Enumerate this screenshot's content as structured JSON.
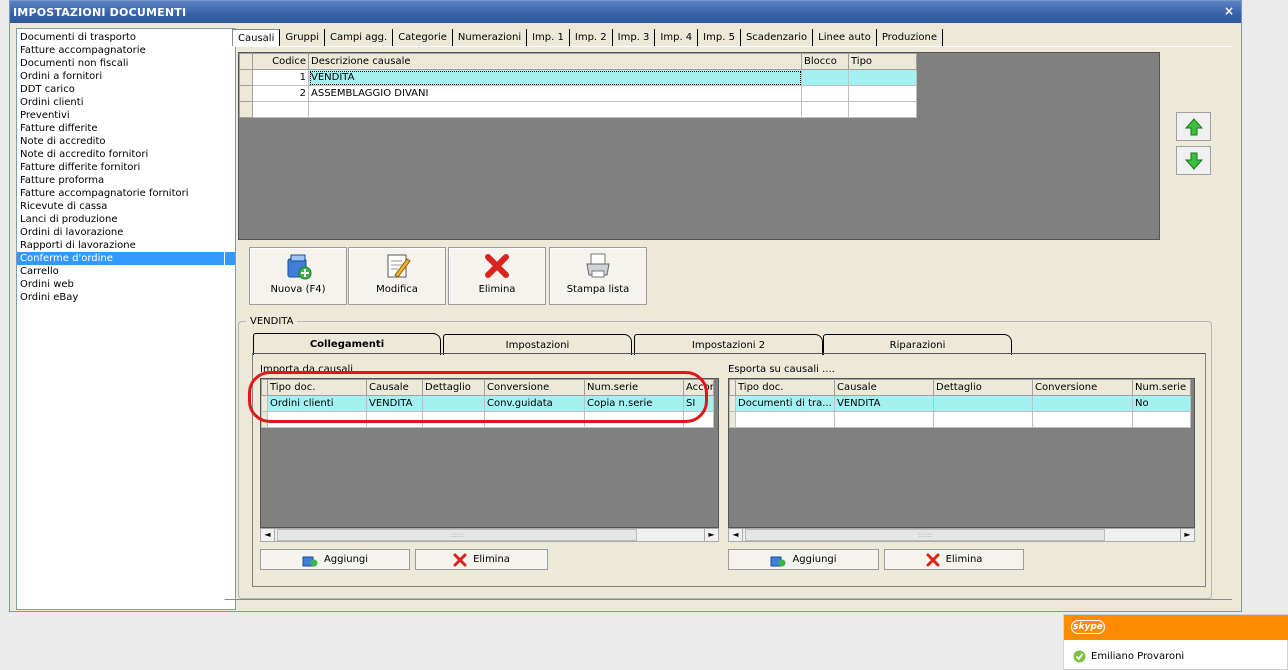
{
  "window": {
    "title": "IMPOSTAZIONI DOCUMENTI",
    "close": "×"
  },
  "doc_list": [
    "Documenti di trasporto",
    "Fatture accompagnatorie",
    "Documenti non fiscali",
    "Ordini a fornitori",
    "DDT carico",
    "Ordini clienti",
    "Preventivi",
    "Fatture differite",
    "Note di accredito",
    "Note di accredito fornitori",
    "Fatture differite fornitori",
    "Fatture proforma",
    "Fatture accompagnatorie fornitori",
    "Ricevute di cassa",
    "Lanci di produzione",
    "Ordini di lavorazione",
    "Rapporti di lavorazione",
    "Conferme d'ordine",
    "Carrello",
    "Ordini web",
    "Ordini eBay"
  ],
  "selected_doc": "Conferme d'ordine",
  "tabs": [
    "Causali",
    "Gruppi",
    "Campi agg.",
    "Categorie",
    "Numerazioni",
    "Imp. 1",
    "Imp. 2",
    "Imp. 3",
    "Imp. 4",
    "Imp. 5",
    "Scadenzario",
    "Linee auto",
    "Produzione"
  ],
  "active_tab": "Causali",
  "causali_grid": {
    "headers": [
      "Codice",
      "Descrizione causale",
      "Blocco",
      "Tipo"
    ],
    "rows": [
      [
        "1",
        "VENDITA",
        "",
        ""
      ],
      [
        "2",
        "ASSEMBLAGGIO DIVANI",
        "",
        ""
      ]
    ]
  },
  "buttons": {
    "nuova": "Nuova (F4)",
    "modifica": "Modifica",
    "elimina": "Elimina",
    "stampa": "Stampa lista"
  },
  "group_title": "VENDITA",
  "lower_tabs": [
    "Collegamenti",
    "Impostazioni",
    "Impostazioni 2",
    "Riparazioni"
  ],
  "import": {
    "label": "Importa da causali",
    "headers": [
      "Tipo doc.",
      "Causale",
      "Dettaglio",
      "Conversione",
      "Num.serie",
      "Accorp"
    ],
    "rows": [
      [
        "Ordini clienti",
        "VENDITA",
        "",
        "Conv.guidata",
        "Copia n.serie",
        "SI"
      ]
    ],
    "add": "Aggiungi",
    "delete": "Elimina"
  },
  "export": {
    "label": "Esporta su causali ....",
    "headers": [
      "Tipo doc.",
      "Causale",
      "Dettaglio",
      "Conversione",
      "Num.serie"
    ],
    "rows": [
      [
        "Documenti di tra...",
        "VENDITA",
        "",
        "",
        "No"
      ]
    ],
    "add": "Aggiungi",
    "delete": "Elimina"
  },
  "scroll_grip": "::::::",
  "skype": {
    "logo": "skype",
    "contact": "Emiliano Provaroni"
  },
  "colors": {
    "title_bar": "#3a63aa",
    "selection": "#3399ff",
    "highlight_row": "#a4f1f1",
    "annotation": "#e0161b",
    "skype_orange": "#ff8c00"
  }
}
